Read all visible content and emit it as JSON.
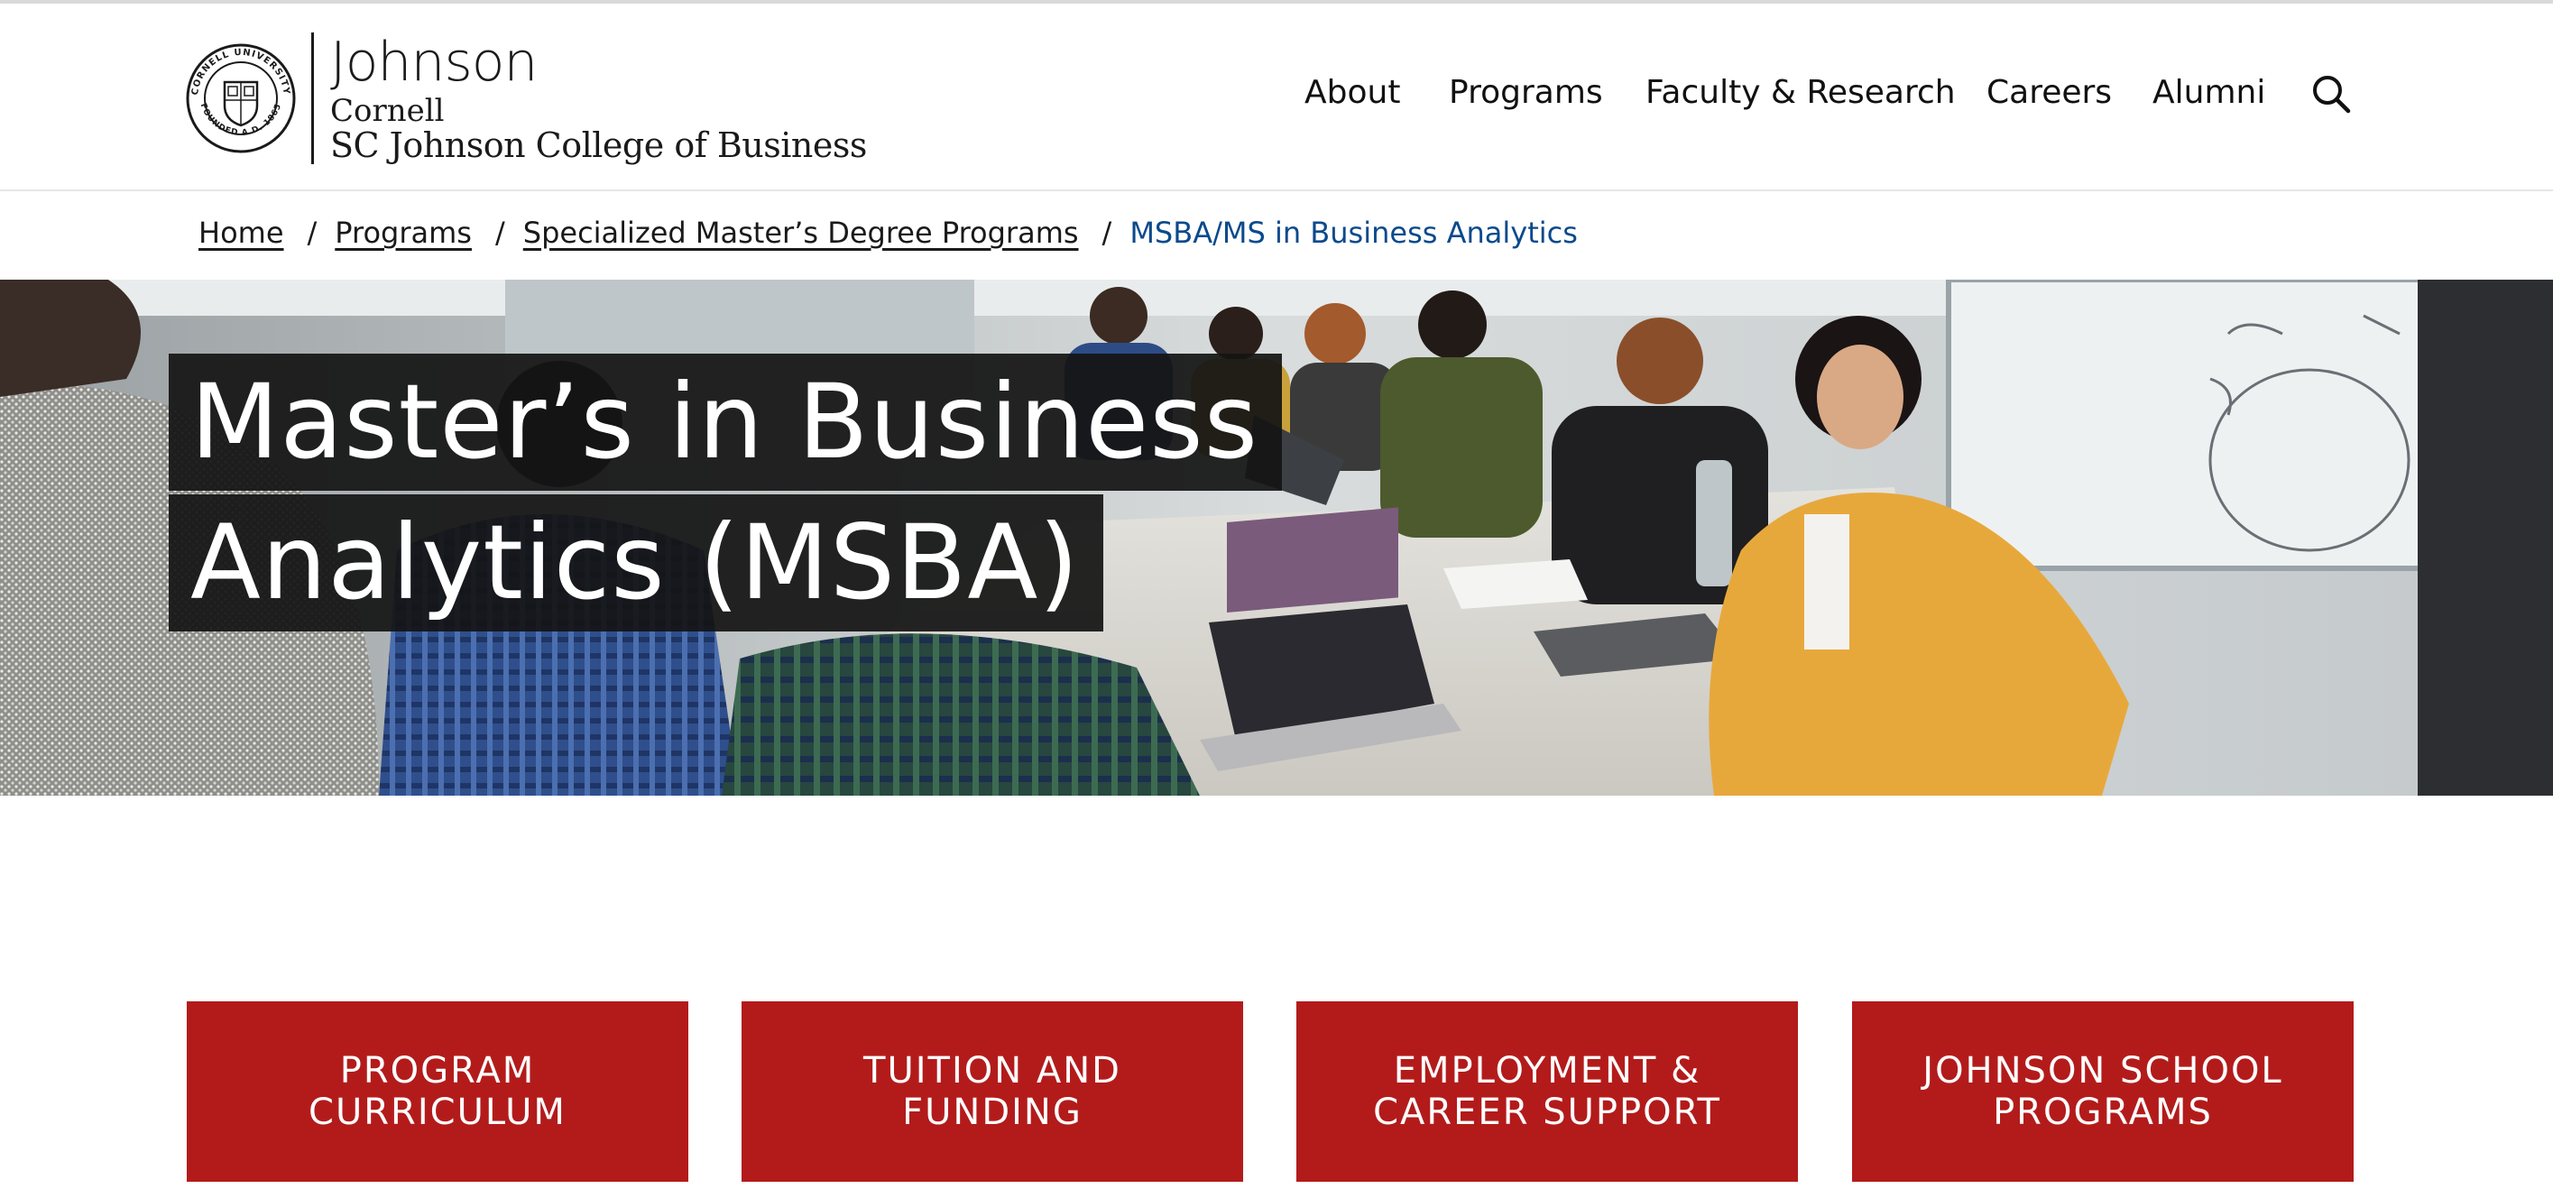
{
  "header": {
    "logo": {
      "seal_text_top": "CORNELL UNIVERSITY",
      "seal_text_bottom": "FOUNDED A.D. 1865",
      "wordmark_line1": "Johnson",
      "wordmark_line2": "Cornell",
      "wordmark_line3": "SC Johnson College of Business"
    },
    "nav": [
      {
        "label": "About"
      },
      {
        "label": "Programs"
      },
      {
        "label": "Faculty & Research"
      },
      {
        "label": "Careers"
      },
      {
        "label": "Alumni"
      }
    ],
    "search_icon": "search-icon"
  },
  "breadcrumb": {
    "items": [
      {
        "label": "Home"
      },
      {
        "label": "Programs"
      },
      {
        "label": "Specialized Master’s Degree Programs"
      }
    ],
    "separator": "/",
    "current": "MSBA/MS in Business Analytics"
  },
  "hero": {
    "title_line1": "Master’s in Business",
    "title_line2": "Analytics (MSBA)"
  },
  "cta_buttons": [
    {
      "line1": "PROGRAM",
      "line2": "CURRICULUM"
    },
    {
      "line1": "TUITION AND",
      "line2": "FUNDING"
    },
    {
      "line1": "EMPLOYMENT &",
      "line2": "CAREER SUPPORT"
    },
    {
      "line1": "JOHNSON SCHOOL",
      "line2": "PROGRAMS"
    }
  ],
  "colors": {
    "brand_red": "#b31b1b",
    "breadcrumb_current": "#0b4a8c",
    "title_background": "#141414"
  }
}
